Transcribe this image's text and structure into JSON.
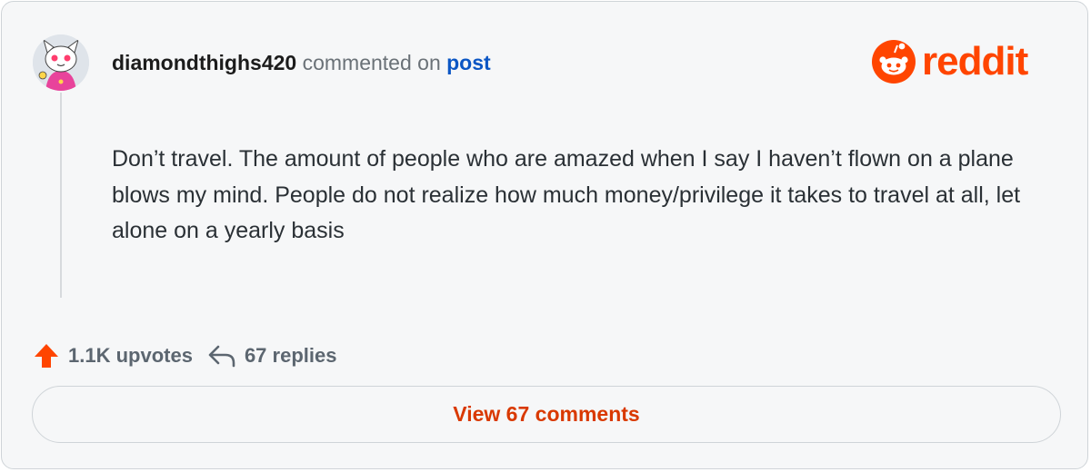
{
  "comment": {
    "username": "diamondthighs420",
    "action_text": "commented on",
    "post_link": "post",
    "body": "Don’t travel. The amount of people who are amazed when I say I haven’t flown on a plane blows my mind. People do not realize how much money/privilege it takes to travel at all, let alone on a yearly basis"
  },
  "brand": {
    "wordmark": "reddit",
    "color": "#ff4500"
  },
  "stats": {
    "upvotes": "1.1K upvotes",
    "replies": "67 replies",
    "upvote_icon": "upvote-arrow-icon",
    "reply_icon": "reply-arrow-icon"
  },
  "cta": {
    "label": "View 67 comments",
    "color": "#d93900"
  },
  "avatar": {
    "icon": "snoo-avatar"
  }
}
